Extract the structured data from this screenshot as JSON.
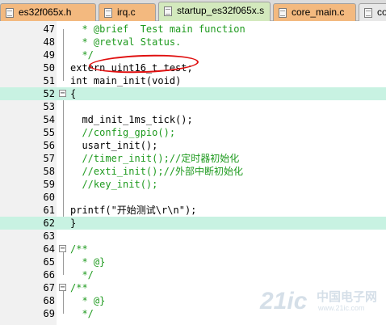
{
  "tabs": [
    {
      "label": "es32f065x.h",
      "style": "orange",
      "active": false
    },
    {
      "label": "irq.c",
      "style": "orange",
      "active": false
    },
    {
      "label": "startup_es32f065x.s",
      "style": "green",
      "active": true
    },
    {
      "label": "core_main.c",
      "style": "orange",
      "active": false
    },
    {
      "label": "co",
      "style": "gray",
      "active": false
    }
  ],
  "colors": {
    "comment": "#1e9a1e",
    "keyword": "#0000cc",
    "string": "#8b2a8b",
    "highlight": "#c8f2e2",
    "annotation": "#e01010"
  },
  "lines": [
    {
      "num": "47",
      "fold": "",
      "parts": [
        {
          "t": "  * @brief  Test main function",
          "c": "comment"
        }
      ]
    },
    {
      "num": "48",
      "fold": "",
      "parts": [
        {
          "t": "  * @retval Status.",
          "c": "comment"
        }
      ]
    },
    {
      "num": "49",
      "fold": "",
      "parts": [
        {
          "t": "  */",
          "c": "comment"
        }
      ]
    },
    {
      "num": "50",
      "fold": "",
      "parts": [
        {
          "t": "extern uint16_t test;",
          "c": "keyword"
        }
      ]
    },
    {
      "num": "51",
      "fold": "",
      "parts": [
        {
          "t": "int ",
          "c": "keyword"
        },
        {
          "t": "main_init(",
          "c": "plain"
        },
        {
          "t": "void",
          "c": "keyword"
        },
        {
          "t": ")",
          "c": "plain"
        }
      ]
    },
    {
      "num": "52",
      "fold": "minus",
      "parts": [
        {
          "t": "{",
          "c": "plain"
        }
      ],
      "highlight": true
    },
    {
      "num": "53",
      "fold": "",
      "parts": []
    },
    {
      "num": "54",
      "fold": "",
      "parts": [
        {
          "t": "  md_init_1ms_tick();",
          "c": "plain"
        }
      ]
    },
    {
      "num": "55",
      "fold": "",
      "parts": [
        {
          "t": "  //config_gpio();",
          "c": "comment"
        }
      ]
    },
    {
      "num": "56",
      "fold": "",
      "parts": [
        {
          "t": "  usart_init();",
          "c": "plain"
        }
      ]
    },
    {
      "num": "57",
      "fold": "",
      "parts": [
        {
          "t": "  //timer_init();//定时器初始化",
          "c": "comment"
        }
      ]
    },
    {
      "num": "58",
      "fold": "",
      "parts": [
        {
          "t": "  //exti_init();//外部中断初始化",
          "c": "comment"
        }
      ]
    },
    {
      "num": "59",
      "fold": "",
      "parts": [
        {
          "t": "  //key_init();",
          "c": "comment"
        }
      ]
    },
    {
      "num": "60",
      "fold": "",
      "parts": []
    },
    {
      "num": "61",
      "fold": "",
      "parts": [
        {
          "t": "printf(",
          "c": "plain"
        },
        {
          "t": "\"开始测试\\r\\n\"",
          "c": "string"
        },
        {
          "t": ");",
          "c": "plain"
        }
      ]
    },
    {
      "num": "62",
      "fold": "",
      "parts": [
        {
          "t": "}",
          "c": "plain"
        }
      ],
      "highlight": true
    },
    {
      "num": "63",
      "fold": "",
      "parts": []
    },
    {
      "num": "64",
      "fold": "minus",
      "parts": [
        {
          "t": "/**",
          "c": "comment"
        }
      ]
    },
    {
      "num": "65",
      "fold": "",
      "parts": [
        {
          "t": "  * @}",
          "c": "comment"
        }
      ]
    },
    {
      "num": "66",
      "fold": "",
      "parts": [
        {
          "t": "  */",
          "c": "comment"
        }
      ]
    },
    {
      "num": "67",
      "fold": "minus",
      "parts": [
        {
          "t": "/**",
          "c": "comment"
        }
      ]
    },
    {
      "num": "68",
      "fold": "",
      "parts": [
        {
          "t": "  * @}",
          "c": "comment"
        }
      ]
    },
    {
      "num": "69",
      "fold": "",
      "parts": [
        {
          "t": "  */",
          "c": "comment"
        }
      ]
    }
  ],
  "watermark": {
    "brand": "21ic",
    "cn": "中国电子网",
    "url": "www.21ic.com"
  }
}
